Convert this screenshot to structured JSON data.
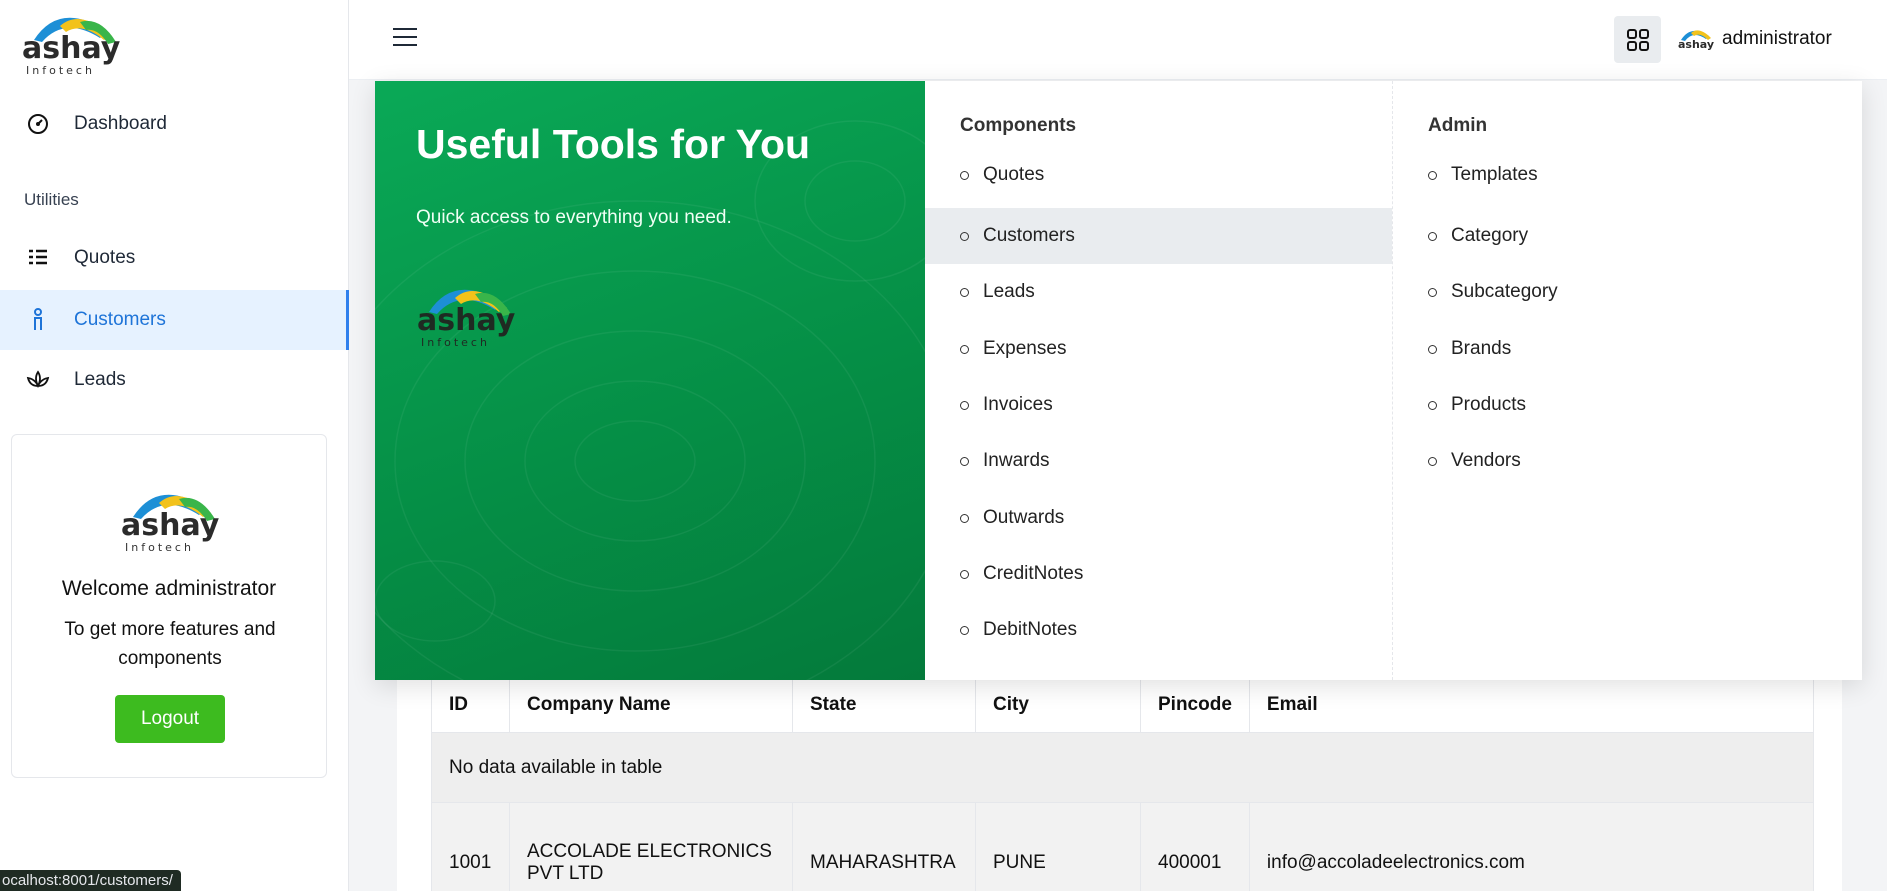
{
  "sidebar": {
    "logo": {
      "brand": "ashay",
      "sub": "Infotech"
    },
    "dashboard": "Dashboard",
    "section": "Utilities",
    "items": [
      {
        "label": "Quotes",
        "icon": "list-icon"
      },
      {
        "label": "Customers",
        "icon": "person-icon",
        "active": true
      },
      {
        "label": "Leads",
        "icon": "lotus-icon"
      }
    ],
    "welcome": {
      "title": "Welcome administrator",
      "subtitle": "To get more features and components",
      "logout": "Logout"
    }
  },
  "header": {
    "user": "administrator"
  },
  "status_url": "ocalhost:8001/customers/",
  "mega_menu": {
    "title": "Useful Tools for You",
    "subtitle": "Quick access to everything you need.",
    "components": {
      "title": "Components",
      "items": [
        "Quotes",
        "Customers",
        "Leads",
        "Expenses",
        "Invoices",
        "Inwards",
        "Outwards",
        "CreditNotes",
        "DebitNotes"
      ]
    },
    "admin": {
      "title": "Admin",
      "items": [
        "Templates",
        "Category",
        "Subcategory",
        "Brands",
        "Products",
        "Vendors"
      ]
    }
  },
  "table": {
    "columns": [
      "ID",
      "Company Name",
      "State",
      "City",
      "Pincode",
      "Email"
    ],
    "empty": "No data available in table",
    "rows": [
      {
        "id": "1001",
        "company": "ACCOLADE ELECTRONICS PVT LTD",
        "state": "MAHARASHTRA",
        "city": "PUNE",
        "pincode": "400001",
        "email": "info@accoladeelectronics.com"
      }
    ]
  },
  "colors": {
    "brand_green": "#07994c",
    "accent_blue": "#1e74d8",
    "logout_green": "#3dbb1f"
  }
}
